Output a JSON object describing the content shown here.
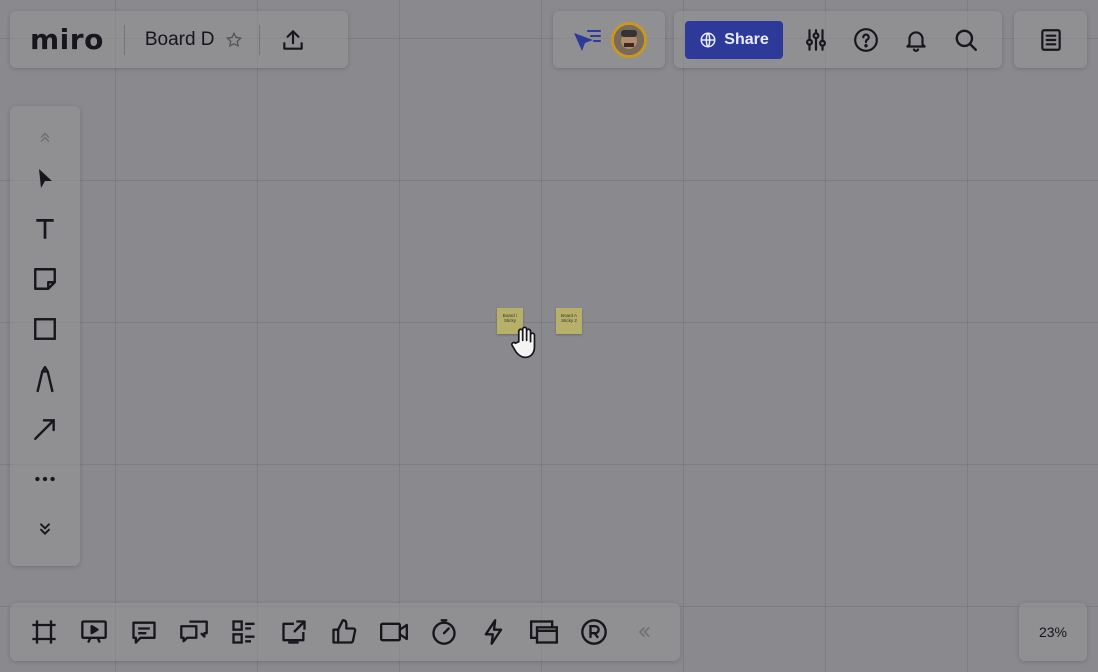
{
  "app": {
    "logo_text": "miro",
    "board_name": "Board D"
  },
  "header": {
    "share_label": "Share"
  },
  "canvas": {
    "stickies": [
      {
        "text": "Board / Sticky"
      },
      {
        "text": "Board A Sticky 2"
      }
    ]
  },
  "zoom": {
    "level": "23%"
  },
  "colors": {
    "share_button": "#2d3a9a",
    "sticky_note": "#b7b068",
    "avatar_ring": "#c79a1d"
  }
}
